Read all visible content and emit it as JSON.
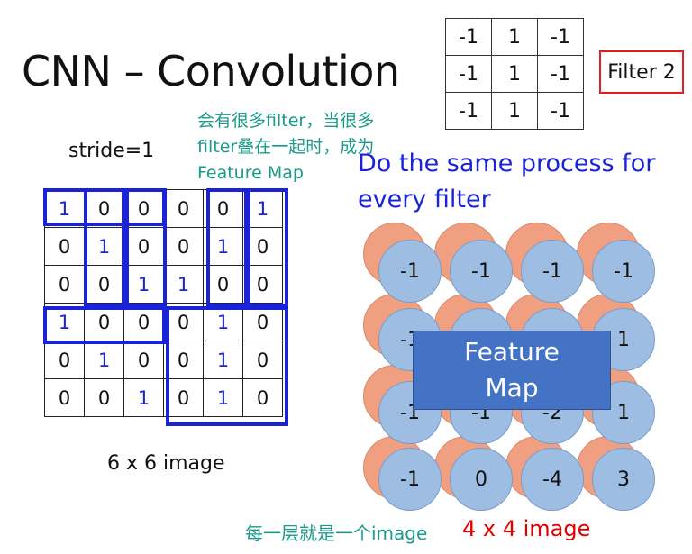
{
  "title": "CNN – Convolution",
  "filter": {
    "rows": [
      [
        "-1",
        "1",
        "-1"
      ],
      [
        "-1",
        "1",
        "-1"
      ],
      [
        "-1",
        "1",
        "-1"
      ]
    ],
    "label": "Filter 2"
  },
  "annotation": [
    "会有很多filter，当很多",
    "filter叠在一起时，成为",
    "Feature Map"
  ],
  "stride": "stride=1",
  "process_text": "Do the same process for every filter",
  "image": {
    "rows": [
      [
        "1",
        "0",
        "0",
        "0",
        "0",
        "1"
      ],
      [
        "0",
        "1",
        "0",
        "0",
        "1",
        "0"
      ],
      [
        "0",
        "0",
        "1",
        "1",
        "0",
        "0"
      ],
      [
        "1",
        "0",
        "0",
        "0",
        "1",
        "0"
      ],
      [
        "0",
        "1",
        "0",
        "0",
        "1",
        "0"
      ],
      [
        "0",
        "0",
        "1",
        "0",
        "1",
        "0"
      ]
    ],
    "caption": "6 x 6 image"
  },
  "feature_map": {
    "values": [
      [
        "-1",
        "-1",
        "-1",
        "-1"
      ],
      [
        "-1",
        "",
        "",
        "1"
      ],
      [
        "-1",
        "-1",
        "-2",
        "1"
      ],
      [
        "-1",
        "0",
        "-4",
        "3"
      ]
    ],
    "label_line1": "Feature",
    "label_line2": "Map"
  },
  "bottom": {
    "caption_cn": "每一层就是一个image",
    "caption_red": "4 x 4 image"
  },
  "colors": {
    "blue": "#1a23d8",
    "teal": "#1a9a8a",
    "red": "#e00000",
    "feature_blue": "#4472c4",
    "circle_blue": "#9dbde3",
    "circle_orange": "#f0a080"
  }
}
